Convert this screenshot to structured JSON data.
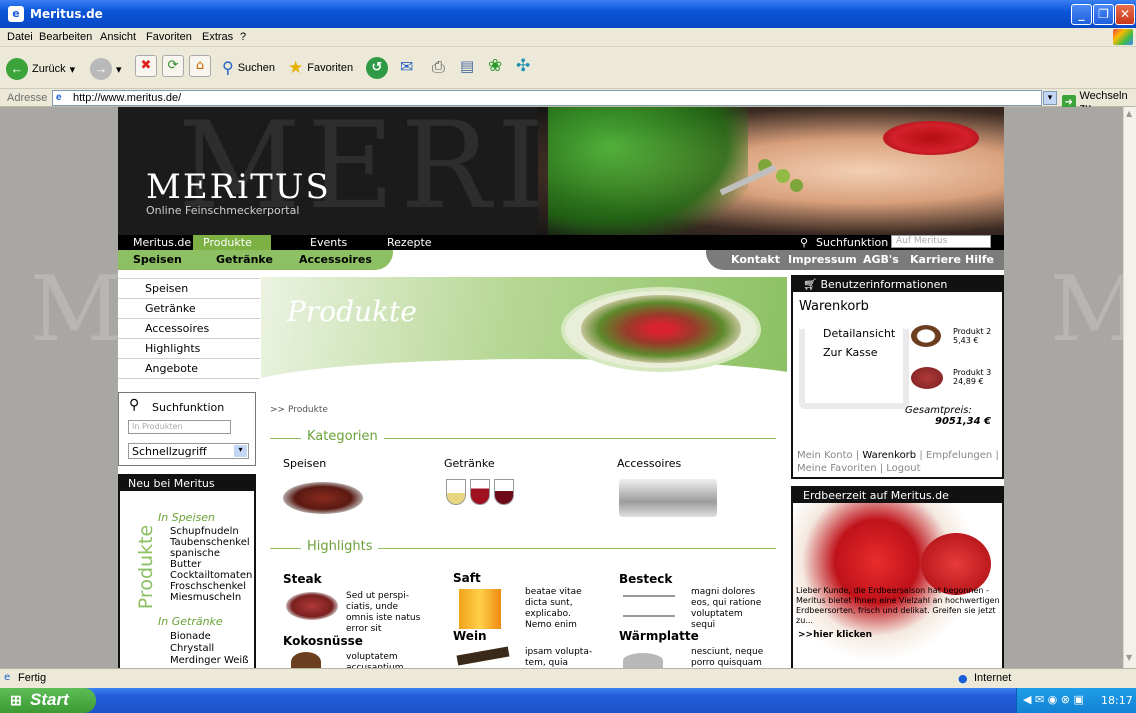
{
  "window": {
    "title": "Meritus.de"
  },
  "menu": [
    "Datei",
    "Bearbeiten",
    "Ansicht",
    "Favoriten",
    "Extras",
    "?"
  ],
  "toolbar": {
    "back": "Zurück",
    "search": "Suchen",
    "favorites": "Favoriten"
  },
  "address": {
    "label": "Adresse",
    "url": "http://www.meritus.de/",
    "go": "Wechseln zu"
  },
  "site": {
    "logo": "MERiTUS",
    "tagline": "Online Feinschmeckerportal",
    "watermark": "MERITUS",
    "nav_main": [
      "Meritus.de",
      "Produkte",
      "Events",
      "Rezepte"
    ],
    "search_label": "Suchfunktion",
    "search_placeholder": "Auf Meritus",
    "nav_sub_left": [
      "Speisen",
      "Getränke",
      "Accessoires"
    ],
    "nav_sub_right": [
      "Kontakt",
      "Impressum",
      "AGB's",
      "Karriere",
      "Hilfe"
    ],
    "sidebar_menu": [
      "Speisen",
      "Getränke",
      "Accessoires",
      "Highlights",
      "Angebote"
    ],
    "side_search": {
      "label": "Suchfunktion",
      "placeholder": "In Produkten",
      "select": "Schnellzugriff"
    },
    "neu": {
      "title": "Neu bei Meritus",
      "vertical": "Produkte",
      "group1": "In Speisen",
      "items1": [
        "Schupfnudeln",
        "Taubenschenkel",
        "spanische Butter",
        "Cocktailtomaten",
        "Froschschenkel",
        "Miesmuscheln"
      ],
      "group2": "In Getränke",
      "items2": [
        "Bionade",
        "Chrystall",
        "Merdinger Weiß"
      ]
    },
    "produkte_title": "Produkte",
    "breadcrumb": ">> Produkte",
    "kategorien": {
      "heading": "Kategorien",
      "items": [
        "Speisen",
        "Getränke",
        "Accessoires"
      ]
    },
    "highlights": {
      "heading": "Highlights",
      "items": [
        {
          "title": "Steak",
          "text": "Sed ut perspi-ciatis, unde omnis iste natus error sit"
        },
        {
          "title": "Saft",
          "text": "beatae vitae dicta sunt, explicabo. Nemo enim"
        },
        {
          "title": "Besteck",
          "text": "magni dolores eos, qui ratione voluptatem sequi"
        },
        {
          "title": "Kokosnüsse",
          "text": "voluptatem accusantium"
        },
        {
          "title": "Wein",
          "text": "ipsam volupta-tem, quia"
        },
        {
          "title": "Wärmplatte",
          "text": "nesciunt, neque porro quisquam"
        }
      ]
    },
    "benutzer": {
      "title": "Benutzerinformationen",
      "warenkorb": "Warenkorb",
      "detail": "Detailansicht",
      "kasse": "Zur Kasse",
      "p2name": "Produkt 2",
      "p2price": "5,43 €",
      "p3name": "Produkt 3",
      "p3price": "24,89 €",
      "gesamt_label": "Gesamtpreis:",
      "gesamt_value": "9051,34 €",
      "links": [
        "Mein Konto",
        "Warenkorb",
        "Empfelungen",
        "Meine Favoriten",
        "Logout"
      ]
    },
    "erdbeer": {
      "title": "Erdbeerzeit auf Meritus.de",
      "text": "Lieber Kunde, die Erdbeersaison hat begonnen - Meritus bietet Ihnen eine Vielzahl an hochwertigen Erdbeersorten, frisch und delikat. Greifen sie jetzt zu...",
      "link": ">>hier klicken"
    }
  },
  "status": {
    "text": "Fertig",
    "zone": "Internet"
  },
  "taskbar": {
    "start": "Start",
    "time": "18:17"
  },
  "colors": {
    "green": "#8cc063",
    "dark": "#111111"
  }
}
